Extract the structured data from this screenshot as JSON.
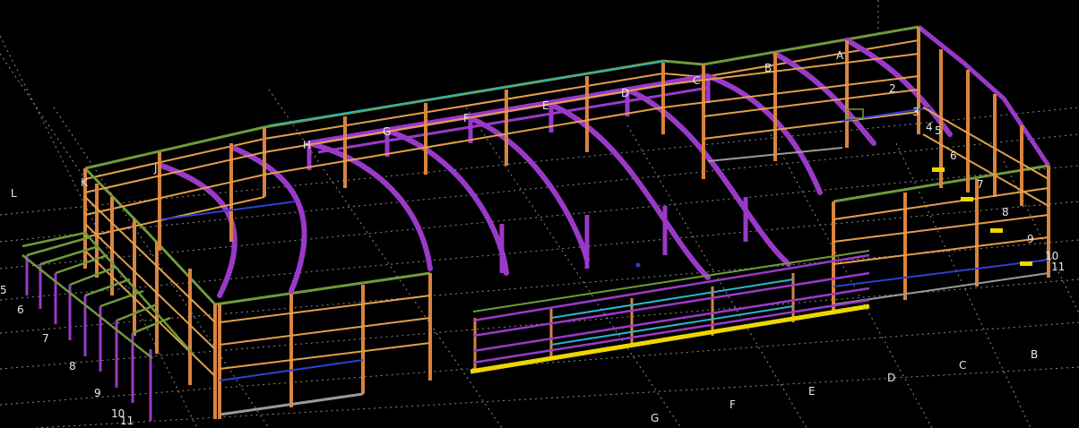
{
  "colors": {
    "background": "#000000",
    "column": "#d9833f",
    "rafter": "#9a39c9",
    "girt": "#e2a04a",
    "eave": "#6f9a3c",
    "brace_blue": "#2f3fd0",
    "cyan": "#27b7c9",
    "grid": "#9a9a9a",
    "yellow": "#f0d600",
    "label": "#e8e8e8"
  },
  "grid_labels": {
    "top_letters": [
      "A",
      "B",
      "C",
      "D",
      "E",
      "F",
      "G",
      "H",
      "J",
      "K"
    ],
    "right_numbers": [
      "2",
      "3",
      "4",
      "5",
      "6",
      "7",
      "8",
      "9",
      "10",
      "11"
    ],
    "left_letter": "L",
    "left_numbers": [
      "5",
      "6",
      "7",
      "8",
      "9",
      "10",
      "11"
    ],
    "bottom_letters": [
      "G",
      "F",
      "E",
      "D",
      "C",
      "B"
    ]
  }
}
